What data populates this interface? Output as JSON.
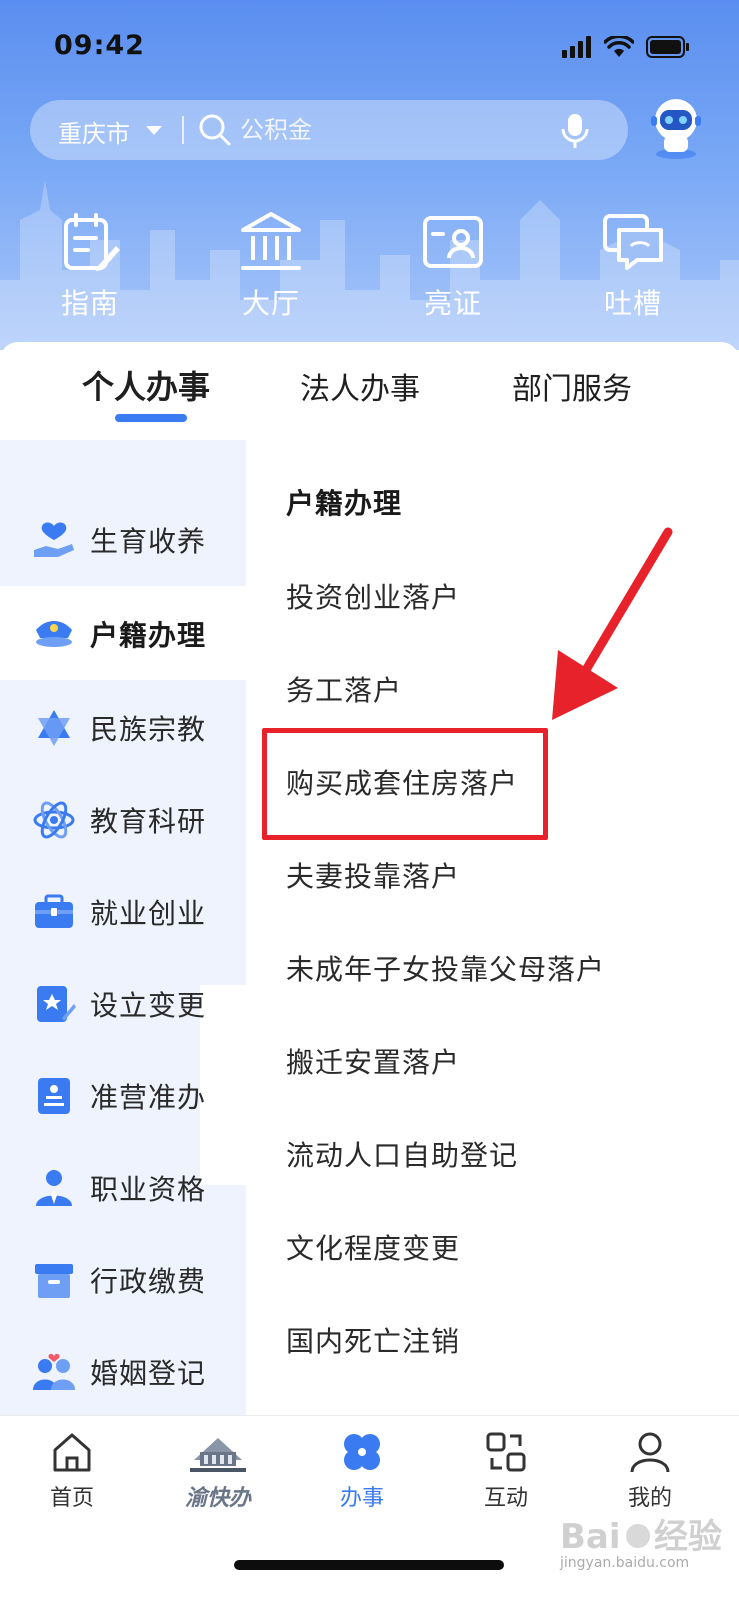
{
  "status_bar": {
    "time": "09:42"
  },
  "search": {
    "city": "重庆市",
    "placeholder": "公积金"
  },
  "quick_actions": [
    {
      "label": "指南",
      "icon": "guide-icon"
    },
    {
      "label": "大厅",
      "icon": "hall-icon"
    },
    {
      "label": "亮证",
      "icon": "id-card-icon"
    },
    {
      "label": "吐槽",
      "icon": "feedback-icon"
    }
  ],
  "tabs": [
    {
      "label": "个人办事",
      "active": true
    },
    {
      "label": "法人办事",
      "active": false
    },
    {
      "label": "部门服务",
      "active": false
    }
  ],
  "sidebar": {
    "items": [
      {
        "label": "生育收养",
        "icon": "hand-heart-icon"
      },
      {
        "label": "户籍办理",
        "icon": "police-cap-icon",
        "active": true
      },
      {
        "label": "民族宗教",
        "icon": "star-of-david-icon"
      },
      {
        "label": "教育科研",
        "icon": "atom-icon"
      },
      {
        "label": "就业创业",
        "icon": "briefcase-icon"
      },
      {
        "label": "设立变更",
        "icon": "document-edit-icon"
      },
      {
        "label": "准营准办",
        "icon": "license-icon"
      },
      {
        "label": "职业资格",
        "icon": "person-tie-icon"
      },
      {
        "label": "行政缴费",
        "icon": "archive-box-icon"
      },
      {
        "label": "婚姻登记",
        "icon": "couple-icon"
      }
    ]
  },
  "content": {
    "title": "户籍办理",
    "items": [
      "投资创业落户",
      "务工落户",
      "购买成套住房落户",
      "夫妻投靠落户",
      "未成年子女投靠父母落户",
      "搬迁安置落户",
      "流动人口自助登记",
      "文化程度变更",
      "国内死亡注销"
    ],
    "highlighted_item": "购买成套住房落户"
  },
  "bottom_nav": [
    {
      "label": "首页",
      "icon": "home-icon"
    },
    {
      "label": "渝快办",
      "icon": "yukuaiban-logo-icon"
    },
    {
      "label": "办事",
      "icon": "four-petal-icon",
      "active": true
    },
    {
      "label": "互动",
      "icon": "interact-icon"
    },
    {
      "label": "我的",
      "icon": "user-icon"
    }
  ],
  "watermark": {
    "text": "jingyan.baidu.com"
  },
  "colors": {
    "accent": "#3b7bf2",
    "highlight": "#e8222a",
    "sidebar_bg": "#eef3fd"
  }
}
